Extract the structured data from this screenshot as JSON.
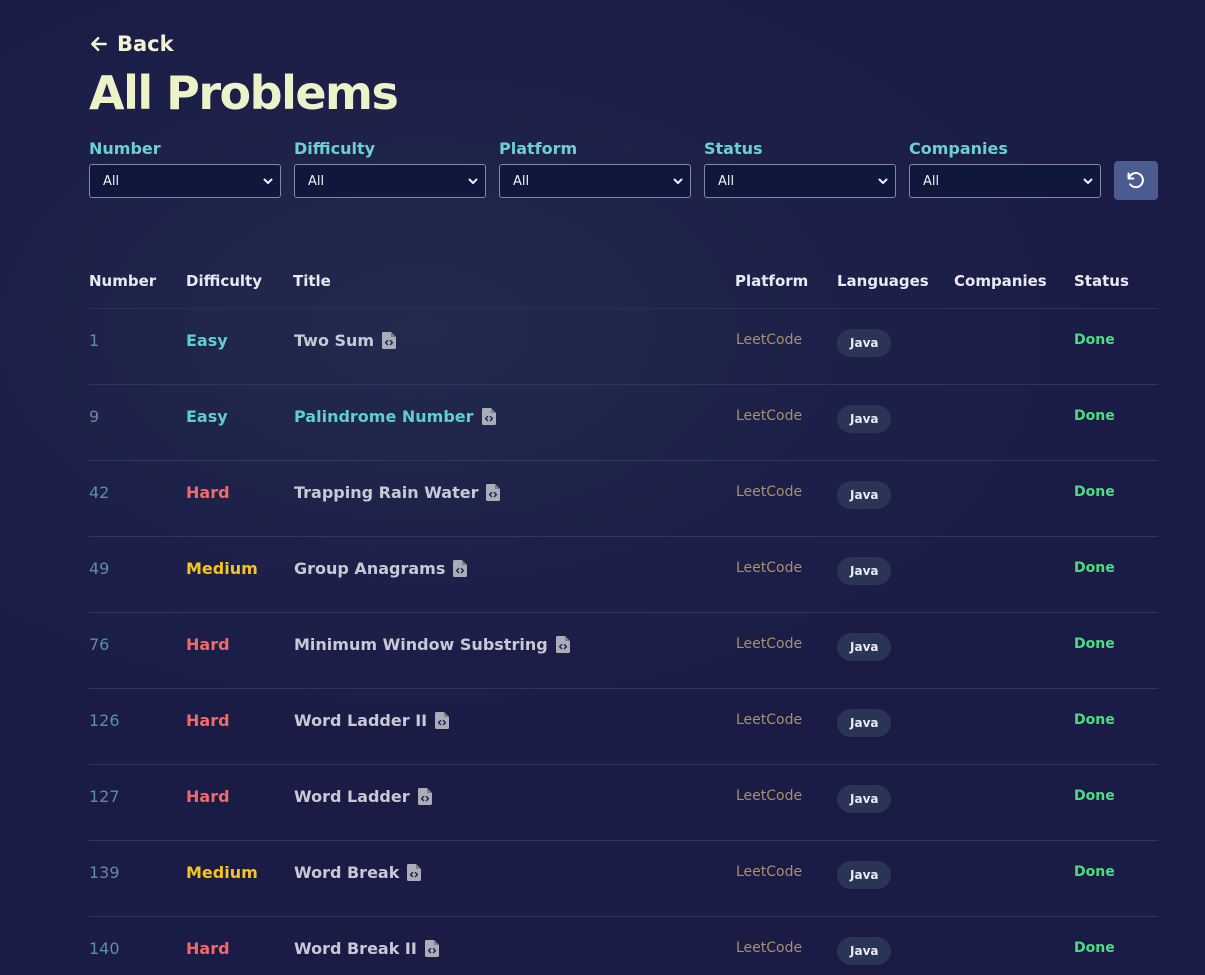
{
  "nav": {
    "back_label": "Back"
  },
  "page": {
    "title": "All Problems"
  },
  "filters": [
    {
      "label": "Number",
      "value": "All"
    },
    {
      "label": "Difficulty",
      "value": "All"
    },
    {
      "label": "Platform",
      "value": "All"
    },
    {
      "label": "Status",
      "value": "All"
    },
    {
      "label": "Companies",
      "value": "All"
    }
  ],
  "table": {
    "headers": [
      "Number",
      "Difficulty",
      "Title",
      "Platform",
      "Languages",
      "Companies",
      "Status"
    ],
    "rows": [
      {
        "number": "1",
        "difficulty": "Easy",
        "title": "Two Sum",
        "platform": "LeetCode",
        "language": "Java",
        "companies": "",
        "status": "Done"
      },
      {
        "number": "9",
        "difficulty": "Easy",
        "title": "Palindrome Number",
        "platform": "LeetCode",
        "language": "Java",
        "companies": "",
        "status": "Done"
      },
      {
        "number": "42",
        "difficulty": "Hard",
        "title": "Trapping Rain Water",
        "platform": "LeetCode",
        "language": "Java",
        "companies": "",
        "status": "Done"
      },
      {
        "number": "49",
        "difficulty": "Medium",
        "title": "Group Anagrams",
        "platform": "LeetCode",
        "language": "Java",
        "companies": "",
        "status": "Done"
      },
      {
        "number": "76",
        "difficulty": "Hard",
        "title": "Minimum Window Substring",
        "platform": "LeetCode",
        "language": "Java",
        "companies": "",
        "status": "Done"
      },
      {
        "number": "126",
        "difficulty": "Hard",
        "title": "Word Ladder II",
        "platform": "LeetCode",
        "language": "Java",
        "companies": "",
        "status": "Done"
      },
      {
        "number": "127",
        "difficulty": "Hard",
        "title": "Word Ladder",
        "platform": "LeetCode",
        "language": "Java",
        "companies": "",
        "status": "Done"
      },
      {
        "number": "139",
        "difficulty": "Medium",
        "title": "Word Break",
        "platform": "LeetCode",
        "language": "Java",
        "companies": "",
        "status": "Done"
      },
      {
        "number": "140",
        "difficulty": "Hard",
        "title": "Word Break II",
        "platform": "LeetCode",
        "language": "Java",
        "companies": "",
        "status": "Done"
      }
    ]
  },
  "colors": {
    "background": "#1a1c45",
    "title": "#eef2c8",
    "filter_label": "#6ccfd0",
    "easy": "#5ccfd0",
    "medium": "#f5c518",
    "hard": "#f06a6a",
    "platform": "#a8906a",
    "status_done": "#4ade80",
    "reset_button": "#4c5c90"
  },
  "icons": {
    "back": "arrow-left-icon",
    "reset": "rotate-ccw-icon",
    "solution": "file-code-icon",
    "select": "chevron-down-icon"
  }
}
